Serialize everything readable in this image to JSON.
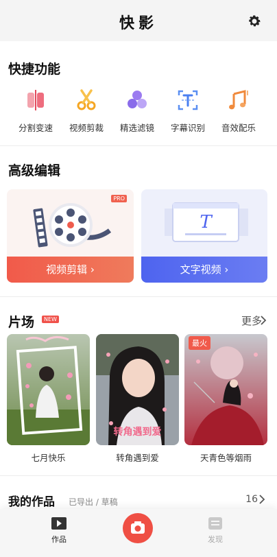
{
  "app": {
    "title": "快影"
  },
  "quick": {
    "title": "快捷功能",
    "items": [
      {
        "label": "分割变速",
        "icon": "split-speed-icon"
      },
      {
        "label": "视频剪裁",
        "icon": "scissors-icon"
      },
      {
        "label": "精选滤镜",
        "icon": "filter-icon"
      },
      {
        "label": "字幕识别",
        "icon": "subtitle-recognize-icon"
      },
      {
        "label": "音效配乐",
        "icon": "music-note-icon"
      }
    ]
  },
  "advanced": {
    "title": "高级编辑",
    "video_edit": {
      "label": "视频剪辑 ›",
      "badge": "PRO"
    },
    "text_video": {
      "label": "文字视频 ›"
    }
  },
  "films": {
    "title": "片场",
    "badge": "NEW",
    "more": "更多",
    "items": [
      {
        "label": "七月快乐"
      },
      {
        "label": "转角遇到爱",
        "caption": "转角遇到爱"
      },
      {
        "label": "天青色等烟雨",
        "tag": "最火"
      }
    ]
  },
  "works": {
    "title": "我的作品",
    "subtitle": "已导出 / 草稿",
    "count": "16"
  },
  "tabs": {
    "works": "作品",
    "discover": "发现"
  },
  "colors": {
    "accent": "#ef4f44",
    "blue": "#4e64ef"
  }
}
